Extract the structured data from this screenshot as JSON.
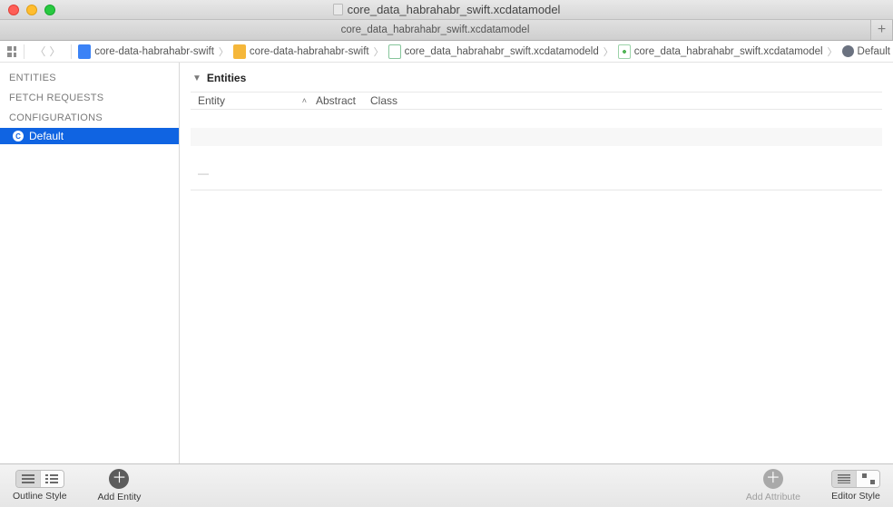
{
  "window": {
    "title": "core_data_habrahabr_swift.xcdatamodel"
  },
  "tabs": {
    "active": "core_data_habrahabr_swift.xcdatamodel",
    "new_label": "+"
  },
  "jumpbar": {
    "items": [
      {
        "label": "core-data-habrahabr-swift",
        "icon": "project"
      },
      {
        "label": "core-data-habrahabr-swift",
        "icon": "folder"
      },
      {
        "label": "core_data_habrahabr_swift.xcdatamodeld",
        "icon": "xcdatamodeld"
      },
      {
        "label": "core_data_habrahabr_swift.xcdatamodel",
        "icon": "xcdatamodel"
      },
      {
        "label": "Default",
        "icon": "config"
      }
    ]
  },
  "sidebar": {
    "headers": {
      "entities": "ENTITIES",
      "fetch": "FETCH REQUESTS",
      "configs": "CONFIGURATIONS"
    },
    "configs": [
      "Default"
    ]
  },
  "editor": {
    "section_title": "Entities",
    "columns": {
      "entity": "Entity",
      "abstract": "Abstract",
      "class": "Class"
    }
  },
  "bottombar": {
    "outline_style": "Outline Style",
    "add_entity": "Add Entity",
    "add_attribute": "Add Attribute",
    "editor_style": "Editor Style"
  }
}
